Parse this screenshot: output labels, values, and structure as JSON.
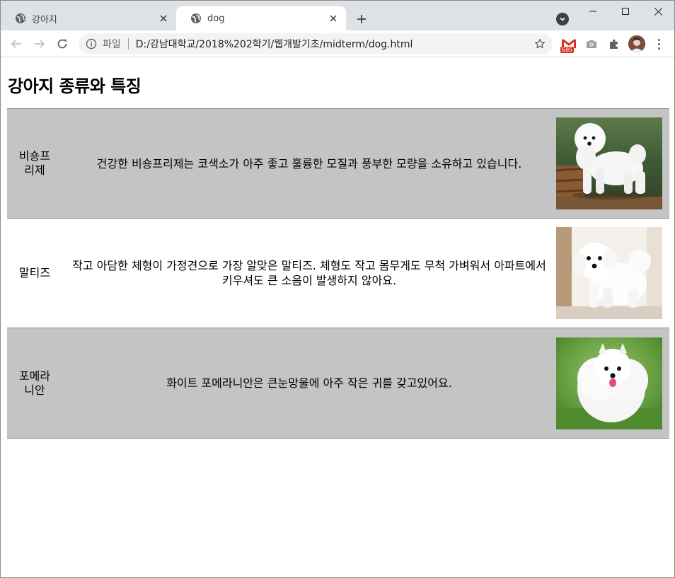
{
  "browser": {
    "tabs": [
      {
        "title": "강아지",
        "active": false
      },
      {
        "title": "dog",
        "active": true
      }
    ],
    "address": {
      "scheme_label": "파일",
      "url": "D:/강남대학교/2018%202학기/웹개발기초/midterm/dog.html"
    },
    "extensions": {
      "gmail_badge": "685"
    }
  },
  "page": {
    "title": "강아지 종류와 특징",
    "rows": [
      {
        "name": "비숑프리제",
        "description": "건강한 비숑프리제는 코색소가 아주 좋고 훌륭한 모질과 풍부한 모량을 소유하고 있습니다.",
        "shaded": true
      },
      {
        "name": "말티즈",
        "description": "작고 아담한 체형이 가정견으로 가장 알맞은 말티즈. 체형도 작고 몸무게도 무척 가벼워서 아파트에서 키우셔도 큰 소음이 발생하지 않아요.",
        "shaded": false
      },
      {
        "name": "포메라니안",
        "description": "화이트 포메라니안은 큰눈망울에 아주 작은 귀를 갖고있어요.",
        "shaded": true
      }
    ]
  },
  "colors": {
    "shaded_row": "#c4c4c4",
    "tabstrip": "#dee1e6",
    "gmail_red": "#d93025"
  }
}
